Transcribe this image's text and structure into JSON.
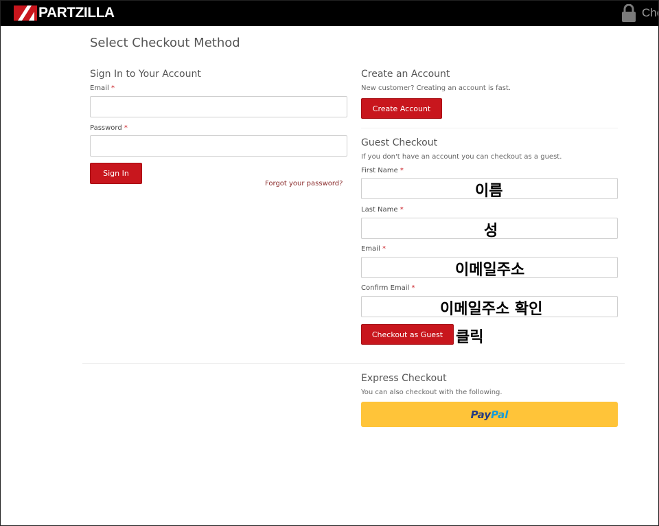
{
  "header": {
    "logo_text": "PARTZILLA",
    "checkout_cut_text": "Che"
  },
  "page": {
    "title": "Select Checkout Method"
  },
  "sign_in": {
    "heading": "Sign In to Your Account",
    "email_label": "Email",
    "email_value": "",
    "password_label": "Password",
    "password_value": "",
    "required_mark": "*",
    "button_label": "Sign In",
    "forgot_link": "Forgot your password?"
  },
  "create_account": {
    "heading": "Create an Account",
    "description": "New customer? Creating an account is fast.",
    "button_label": "Create Account"
  },
  "guest": {
    "heading": "Guest Checkout",
    "description": "If you don't have an account you can checkout as a guest.",
    "first_name_label": "First Name",
    "last_name_label": "Last Name",
    "email_label": "Email",
    "confirm_email_label": "Confirm Email",
    "required_mark": "*",
    "button_label": "Checkout as Guest"
  },
  "express": {
    "heading": "Express Checkout",
    "description": "You can also checkout with the following.",
    "paypal_part1": "Pay",
    "paypal_part2": "Pal"
  },
  "annotations": {
    "first_name": "이름",
    "last_name": "성",
    "email": "이메일주소",
    "confirm_email": "이메일주소 확인",
    "click": "클릭"
  },
  "colors": {
    "accent": "#c8161d",
    "paypal_yellow": "#ffc439",
    "topbar": "#000000"
  }
}
